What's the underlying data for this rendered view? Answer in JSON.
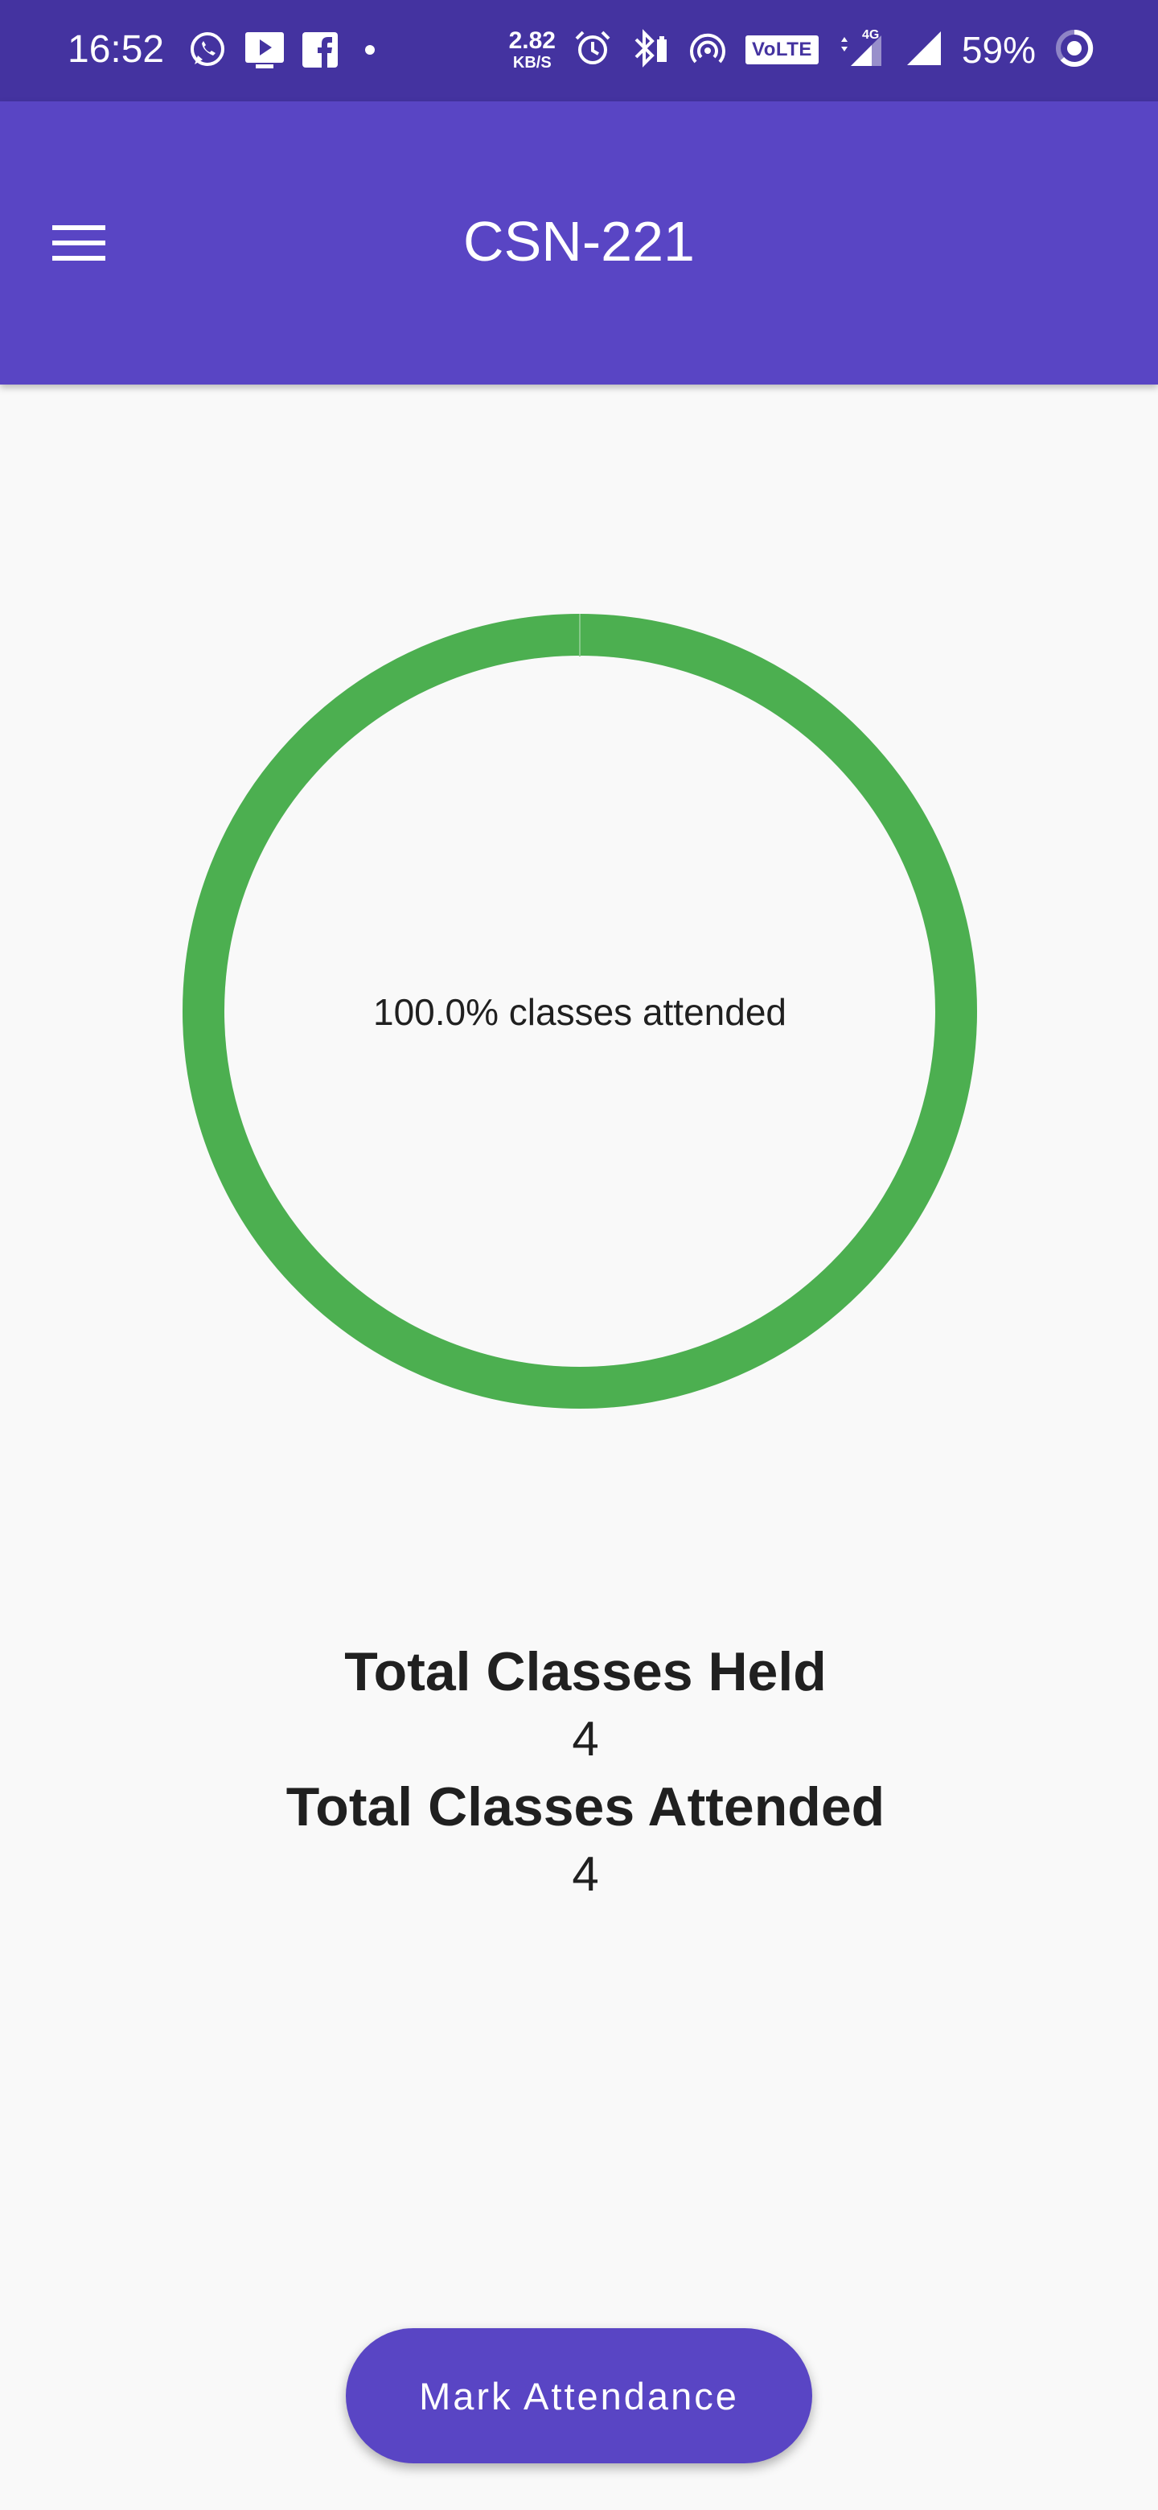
{
  "status_bar": {
    "time": "16:52",
    "net_speed_value": "2.82",
    "net_speed_unit": "KB/S",
    "volte_label": "VoLTE",
    "network_type": "4G",
    "battery": "59%",
    "left_icons": [
      "whatsapp-icon",
      "tv-icon",
      "facebook-icon",
      "dot-icon"
    ],
    "right_icons": [
      "alarm-icon",
      "bluetooth-icon",
      "hotspot-icon",
      "volte-icon",
      "signal-icon",
      "battery-icon"
    ]
  },
  "app_bar": {
    "title": "CSN-221",
    "background": "#5945c4"
  },
  "attendance": {
    "ring_label": "100.0% classes attended",
    "attended_fraction": 1.0,
    "ring_color": "#4caf50",
    "total_held_label": "Total Classes Held",
    "total_held_value": "4",
    "total_attended_label": "Total Classes Attended",
    "total_attended_value": "4"
  },
  "actions": {
    "mark_attendance_label": "Mark Attendance"
  }
}
